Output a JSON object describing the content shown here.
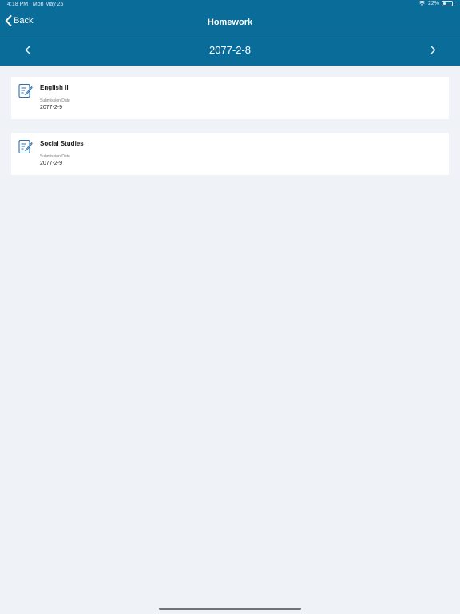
{
  "status_bar": {
    "time": "4:18 PM",
    "date": "Mon May 25",
    "battery": "22%",
    "battery_level": 0.22
  },
  "header": {
    "back_label": "Back",
    "title": "Homework"
  },
  "date_nav": {
    "current_date": "2077-2-8"
  },
  "homework": [
    {
      "subject": "English II",
      "submission_label": "Submission Date",
      "submission_date": "2077-2-9"
    },
    {
      "subject": "Social Studies",
      "submission_label": "Submission Date",
      "submission_date": "2077-2-9"
    }
  ],
  "colors": {
    "header_bg": "#0a6c98",
    "page_bg": "#eff2f6",
    "icon_accent": "#2a6fb0"
  }
}
